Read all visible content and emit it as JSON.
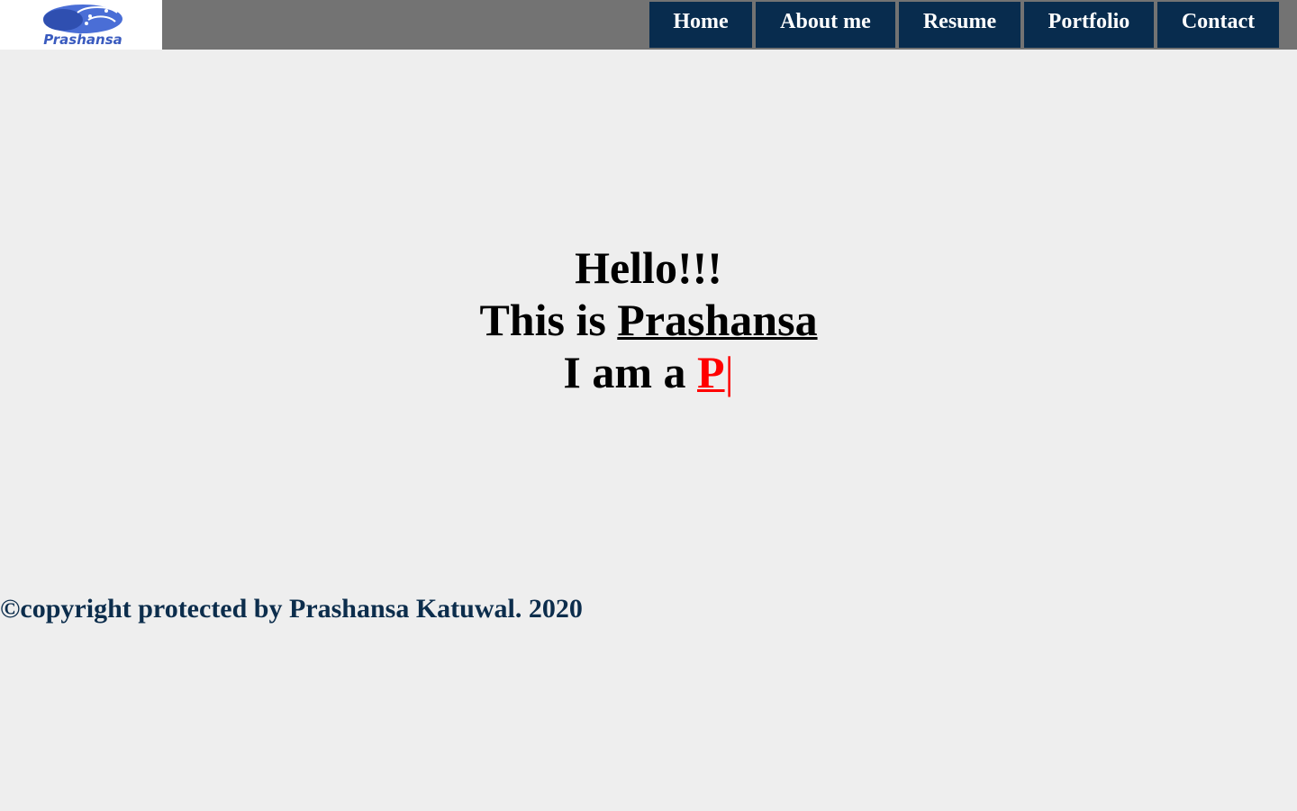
{
  "header": {
    "logo_text": "Prashansa",
    "nav": [
      {
        "label": "Home"
      },
      {
        "label": "About me"
      },
      {
        "label": "Resume"
      },
      {
        "label": "Portfolio"
      },
      {
        "label": "Contact"
      }
    ]
  },
  "hero": {
    "greeting": "Hello!!!",
    "intro_prefix": "This is ",
    "intro_name": "Prashansa",
    "role_prefix": "I am a ",
    "role_typed": "P",
    "cursor": "|"
  },
  "footer": {
    "copyright": "©copyright protected by Prashansa Katuwal. 2020"
  },
  "colors": {
    "header_bg": "#737373",
    "nav_bg": "#082c4e",
    "page_bg": "#eeeeee",
    "accent": "#ff0000",
    "footer_text": "#0c2d4c",
    "logo_blue": "#3a5bbf"
  }
}
